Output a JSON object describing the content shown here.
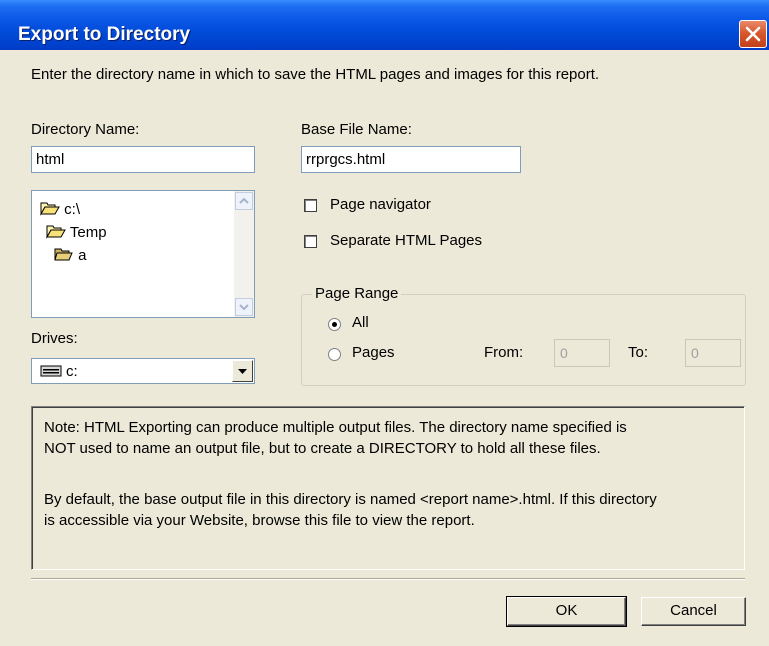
{
  "window": {
    "title": "Export to Directory"
  },
  "intro_text": "Enter the directory name in which to save the HTML pages and images for this report.",
  "directory": {
    "label": "Directory Name:",
    "value": "html",
    "tree": [
      {
        "name": "c:\\",
        "icon": "open-folder-icon"
      },
      {
        "name": "Temp",
        "icon": "open-folder-icon"
      },
      {
        "name": "a",
        "icon": "folder-icon"
      }
    ],
    "drives_label": "Drives:",
    "drive_value": "c:"
  },
  "base_file": {
    "label": "Base File Name:",
    "value": "rrprgcs.html"
  },
  "options": {
    "page_navigator": {
      "label": "Page navigator",
      "checked": false
    },
    "separate_pages": {
      "label": "Separate HTML Pages",
      "checked": false
    }
  },
  "page_range": {
    "legend": "Page Range",
    "all_label": "All",
    "pages_label": "Pages",
    "selected": "All",
    "from_label": "From:",
    "from_value": "0",
    "to_label": "To:",
    "to_value": "0"
  },
  "note": {
    "line1": "Note: HTML Exporting can produce multiple output files. The directory name specified is",
    "line2": "NOT used to name an output file, but to create a DIRECTORY to hold all these files.",
    "line3": "By default, the base output file in this directory is named <report name>.html. If this directory",
    "line4": "is accessible via your Website, browse this file to view the report."
  },
  "buttons": {
    "ok": "OK",
    "cancel": "Cancel"
  },
  "colors": {
    "titlebar": "#0a56e6",
    "dialog_bg": "#ece9d8",
    "close_button": "#d85a2e"
  }
}
